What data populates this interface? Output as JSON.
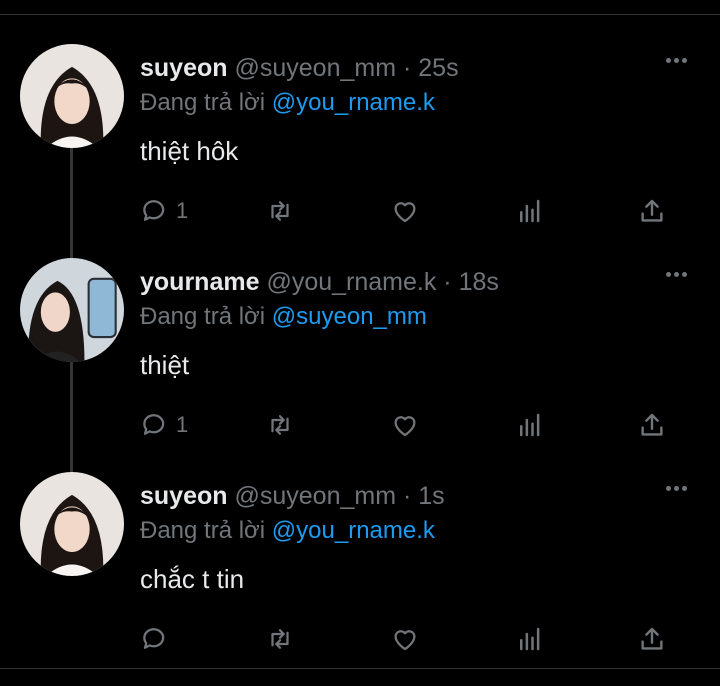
{
  "colors": {
    "background": "#000000",
    "text": "#e7e9ea",
    "muted": "#71767b",
    "accent": "#1d9bf0"
  },
  "tweets": [
    {
      "name": "suyeon",
      "handle": "@suyeon_mm",
      "dot": "·",
      "time": "25s",
      "reply_prefix": "Đang trả lời",
      "reply_to": "@you_rname.k",
      "text": "thiệt hôk",
      "reply_count": "1",
      "avatar": "avatar-photo"
    },
    {
      "name": "yourname",
      "handle": "@you_rname.k",
      "dot": "·",
      "time": "18s",
      "reply_prefix": "Đang trả lời",
      "reply_to": "@suyeon_mm",
      "text": "thiệt",
      "reply_count": "1",
      "avatar": "avatar-photo"
    },
    {
      "name": "suyeon",
      "handle": "@suyeon_mm",
      "dot": "·",
      "time": "1s",
      "reply_prefix": "Đang trả lời",
      "reply_to": "@you_rname.k",
      "text": "chắc t tin",
      "reply_count": "",
      "avatar": "avatar-photo"
    }
  ],
  "icons": [
    "more-icon",
    "reply-icon",
    "retweet-icon",
    "like-icon",
    "views-icon",
    "share-icon"
  ]
}
